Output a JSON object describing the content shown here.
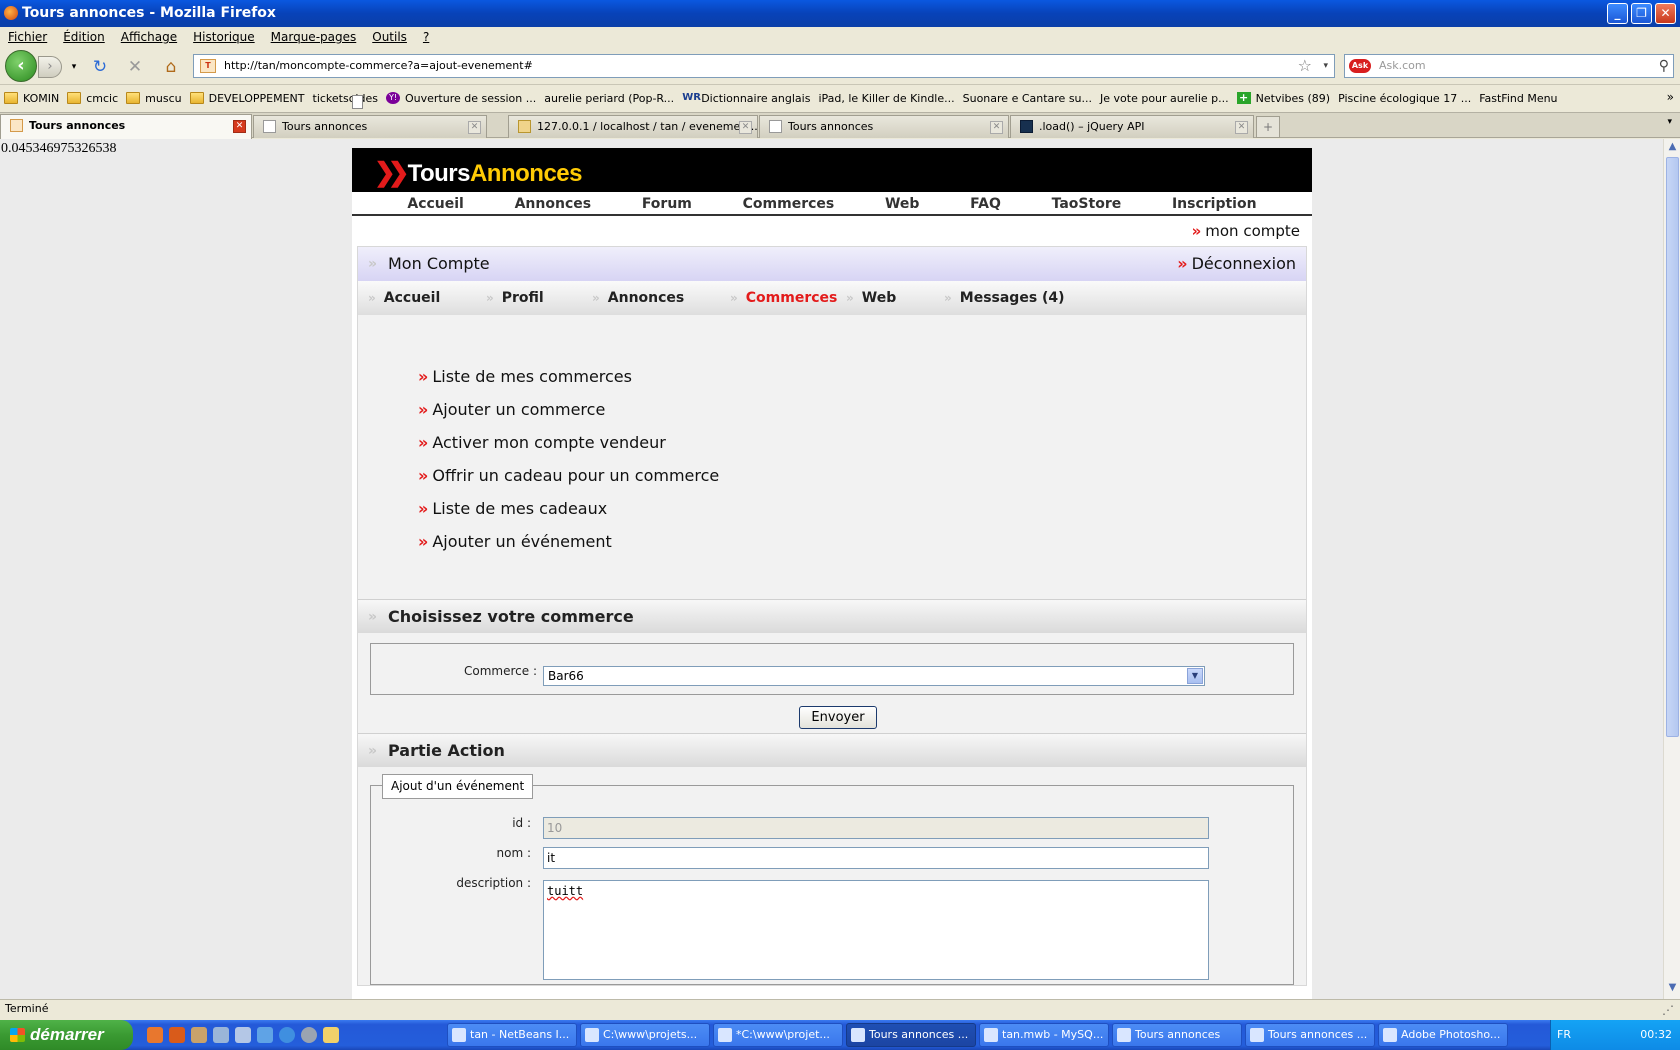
{
  "window": {
    "title": "Tours annonces - Mozilla Firefox"
  },
  "menu": [
    "Fichier",
    "Édition",
    "Affichage",
    "Historique",
    "Marque-pages",
    "Outils",
    "?"
  ],
  "nav": {
    "url": "http://tan/moncompte-commerce?a=ajout-evenement#",
    "search_placeholder": "Ask.com",
    "ask_label": "Ask"
  },
  "bookmarks": [
    {
      "label": "KOMIN",
      "icon": "folder"
    },
    {
      "label": "cmcic",
      "icon": "folder"
    },
    {
      "label": "muscu",
      "icon": "folder"
    },
    {
      "label": "DEVELOPPEMENT",
      "icon": "folder"
    },
    {
      "label": "ticketsoldes",
      "icon": "page"
    },
    {
      "label": "Ouverture de session ...",
      "icon": "yahoo"
    },
    {
      "label": "aurelie periard (Pop-R...",
      "icon": "page"
    },
    {
      "label": "Dictionnaire anglais",
      "icon": "wr"
    },
    {
      "label": "iPad, le Killer de Kindle...",
      "icon": "page"
    },
    {
      "label": "Suonare e Cantare su...",
      "icon": "page"
    },
    {
      "label": "Je vote pour aurelie p...",
      "icon": "page"
    },
    {
      "label": "Netvibes (89)",
      "icon": "nv"
    },
    {
      "label": "Piscine écologique 17 ...",
      "icon": "page"
    },
    {
      "label": "FastFind Menu",
      "icon": "page"
    }
  ],
  "tabs": [
    {
      "label": "Tours annonces",
      "active": true
    },
    {
      "label": "Tours annonces",
      "active": false
    },
    {
      "label": "127.0.0.1 / localhost / tan / evenemen...",
      "active": false
    },
    {
      "label": "Tours annonces",
      "active": false
    },
    {
      "label": ".load() – jQuery API",
      "active": false
    }
  ],
  "debug_value": "0.045346975326538",
  "site": {
    "logo_part1": "Tours",
    "logo_part2": "Annonces",
    "topnav": [
      "Accueil",
      "Annonces",
      "Forum",
      "Commerces",
      "Web",
      "FAQ",
      "TaoStore",
      "Inscription"
    ],
    "account_link": "mon compte",
    "section_title": "Mon Compte",
    "logout": "Déconnexion",
    "subnav": [
      "Accueil",
      "Profil",
      "Annonces",
      "Commerces",
      "Web",
      "Messages (4)"
    ],
    "subnav_current": "Commerces",
    "links": [
      "Liste de mes commerces",
      "Ajouter un commerce",
      "Activer mon compte vendeur",
      "Offrir un cadeau pour un commerce",
      "Liste de mes cadeaux",
      "Ajouter un événement"
    ],
    "choose": {
      "title": "Choisissez votre commerce",
      "label": "Commerce :",
      "selected": "Bar66",
      "button": "Envoyer"
    },
    "action": {
      "title": "Partie Action",
      "legend": "Ajout d'un événement",
      "id_label": "id :",
      "id_value": "10",
      "nom_label": "nom :",
      "nom_value": "it",
      "desc_label": "description :",
      "desc_value": "tuitt"
    }
  },
  "status": "Terminé",
  "taskbar": {
    "start": "démarrer",
    "tasks": [
      "tan - NetBeans I...",
      "C:\\www\\projets...",
      "*C:\\www\\projet...",
      "Tours annonces ...",
      "tan.mwb - MySQ...",
      "Tours annonces",
      "Tours annonces ...",
      "Adobe Photosho..."
    ],
    "active_task": 3,
    "lang": "FR",
    "clock": "00:32"
  },
  "colors": {
    "accent_red": "#e31b1b",
    "logo_yellow": "#ffcb05",
    "xp_blue": "#245edb"
  }
}
